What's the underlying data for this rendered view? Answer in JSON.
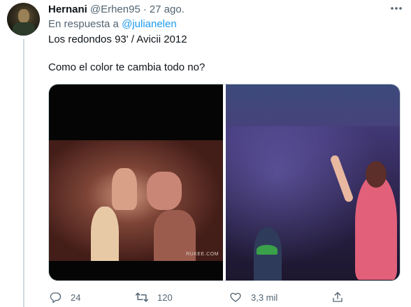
{
  "tweet": {
    "display_name": "Hernani",
    "handle": "@Erhen95",
    "separator": "·",
    "date": "27 ago.",
    "reply_prefix": "En respuesta a",
    "reply_mention": "@julianelen",
    "text_line1": "Los redondos 93' / Avicii 2012",
    "text_line2": "Como el color te cambia todo no?",
    "media": {
      "watermark": "RUKEE.COM"
    },
    "actions": {
      "reply_count": "24",
      "retweet_count": "120",
      "like_count": "3,3 mil"
    }
  },
  "colors": {
    "text_primary": "#0f1419",
    "text_secondary": "#536471",
    "accent": "#1d9bf0",
    "border": "#cfd9de"
  },
  "icons": {
    "more": "more-icon",
    "reply": "reply-icon",
    "retweet": "retweet-icon",
    "like": "heart-icon",
    "share": "share-icon"
  }
}
